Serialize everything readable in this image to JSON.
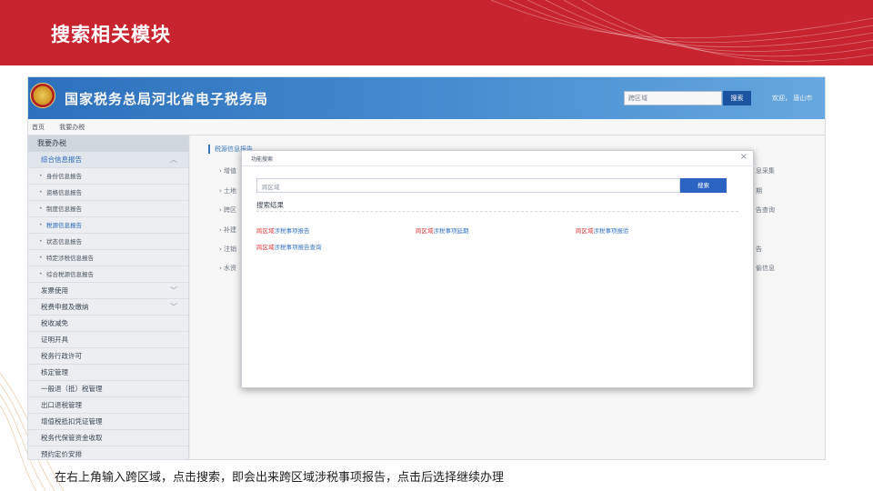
{
  "slide": {
    "title": "搜索相关模块",
    "caption": "在右上角输入跨区域，点击搜索，即会出来跨区域涉税事项报告，点击后选择继续办理"
  },
  "site": {
    "title": "国家税务总局河北省电子税务局",
    "search_value": "跨区域",
    "search_button": "搜索",
    "header_links": "欢迎，  唐山市"
  },
  "breadcrumb": [
    "首页",
    "我要办税"
  ],
  "sidebar": {
    "top": "我要办税",
    "items": [
      {
        "label": "综合信息报告",
        "type": "group",
        "chevron": "︿"
      },
      {
        "label": "身份信息报告",
        "type": "sub"
      },
      {
        "label": "资格信息报告",
        "type": "sub"
      },
      {
        "label": "制度信息报告",
        "type": "sub"
      },
      {
        "label": "税源信息报告",
        "type": "sub-active"
      },
      {
        "label": "状态信息报告",
        "type": "sub"
      },
      {
        "label": "特定涉税信息报告",
        "type": "sub"
      },
      {
        "label": "综合税源信息报告",
        "type": "sub"
      },
      {
        "label": "发票使用",
        "type": "item",
        "chevron": "﹀"
      },
      {
        "label": "税费申报及缴纳",
        "type": "item",
        "chevron": "﹀"
      },
      {
        "label": "税收减免",
        "type": "item"
      },
      {
        "label": "证明开具",
        "type": "item"
      },
      {
        "label": "税务行政许可",
        "type": "item"
      },
      {
        "label": "核定管理",
        "type": "item"
      },
      {
        "label": "一般退（抵）税管理",
        "type": "item"
      },
      {
        "label": "出口退税管理",
        "type": "item"
      },
      {
        "label": "增值税抵扣凭证管理",
        "type": "item"
      },
      {
        "label": "税务代保管资金收取",
        "type": "item"
      },
      {
        "label": "预约定价安排",
        "type": "item"
      }
    ]
  },
  "main": {
    "heading": "税源信息报告",
    "left_rows": [
      "增值",
      "土地",
      "跨区",
      "补建",
      "注销",
      "水资"
    ],
    "right_rows": [
      "息采集",
      "期",
      "告查询",
      "",
      "告",
      "偷信息"
    ]
  },
  "modal": {
    "title": "功能搜索",
    "close": "×",
    "input_value": "跨区域",
    "search_button": "搜索",
    "results_label": "搜索结果",
    "results": [
      {
        "highlight": "跨区域",
        "rest": "涉税事项报告"
      },
      {
        "highlight": "跨区域",
        "rest": "涉税事项延期"
      },
      {
        "highlight": "跨区域",
        "rest": "涉税事项报验"
      },
      {
        "highlight": "跨区域",
        "rest": "涉税事项报告查询"
      }
    ]
  }
}
